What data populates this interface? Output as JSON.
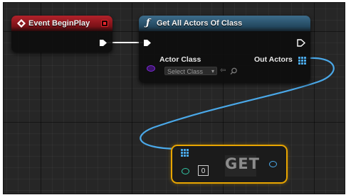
{
  "event_node": {
    "title": "Event BeginPlay",
    "header_color": "#b3222a",
    "icons": [
      "event-diamond-icon",
      "delegate-pin-icon",
      "exec-out-pin-icon"
    ]
  },
  "function_node": {
    "title": "Get All Actors Of Class",
    "header_color": "#3d6c8b",
    "inputs": {
      "actor_class_label": "Actor Class",
      "actor_class_value": "Select Class",
      "caret": "▾"
    },
    "outputs": {
      "out_actors_label": "Out Actors"
    },
    "icons": [
      "function-icon",
      "exec-in-pin-icon",
      "exec-out-pin-icon",
      "class-pin-icon",
      "array-pin-icon",
      "use-selected-arrow-icon",
      "browse-icon"
    ]
  },
  "get_node": {
    "title": "GET",
    "index_value": "0",
    "border_color": "#e8a500",
    "icons": [
      "array-in-pin-icon",
      "index-pin-icon",
      "output-pin-icon"
    ]
  },
  "colors": {
    "canvas": "#262626",
    "exec_wire": "#ffffff",
    "array_wire": "#4aa8e8",
    "class_pin": "#7b2bd6",
    "int_pin": "#33c7a6"
  }
}
